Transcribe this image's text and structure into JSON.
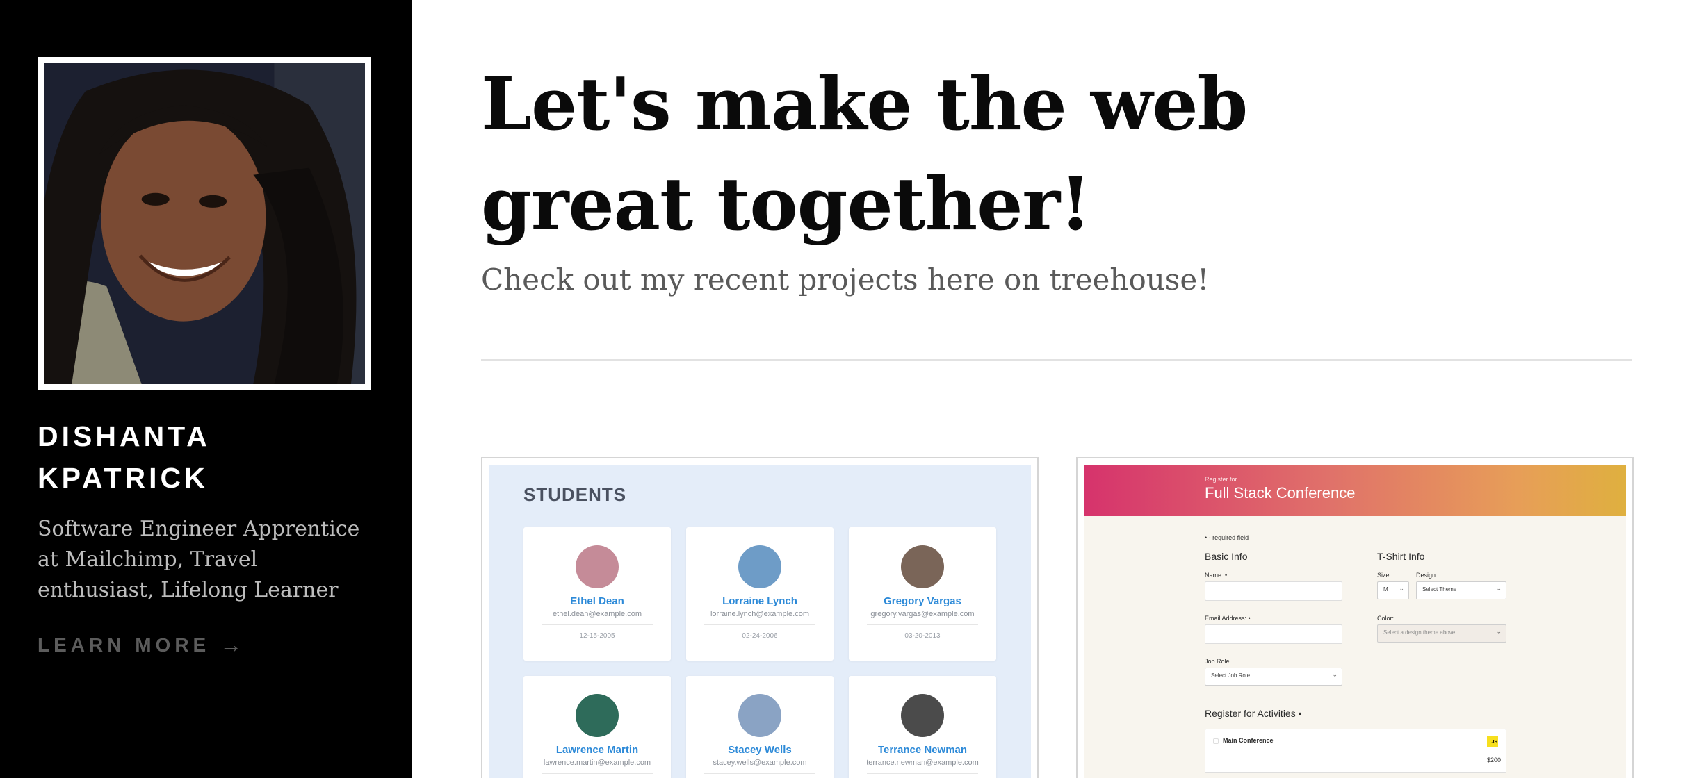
{
  "sidebar": {
    "avatar_alt": "Portrait of Dishanta Kpatrick",
    "name_line1": "DISHANTA",
    "name_line2": "KPATRICK",
    "bio": "Software Engineer Apprentice at Mailchimp, Travel enthusiast, Lifelong Learner",
    "learn_more": "LEARN MORE",
    "learn_more_arrow": "→",
    "background_color": "#000000"
  },
  "main": {
    "headline": "Let's make the web great together!",
    "subheadline": "Check out my recent projects here on treehouse!"
  },
  "projects": [
    {
      "title": "STUDENTS",
      "students": [
        {
          "name": "Ethel Dean",
          "email": "ethel.dean@example.com",
          "date": "12-15-2005",
          "color": "#c58b98"
        },
        {
          "name": "Lorraine Lynch",
          "email": "lorraine.lynch@example.com",
          "date": "02-24-2006",
          "color": "#6e9cc7"
        },
        {
          "name": "Gregory Vargas",
          "email": "gregory.vargas@example.com",
          "date": "03-20-2013",
          "color": "#7a6558"
        },
        {
          "name": "Lawrence Martin",
          "email": "lawrence.martin@example.com",
          "date": "",
          "color": "#2e6b5a"
        },
        {
          "name": "Stacey Wells",
          "email": "stacey.wells@example.com",
          "date": "",
          "color": "#8aa3c4"
        },
        {
          "name": "Terrance Newman",
          "email": "terrance.newman@example.com",
          "date": "",
          "color": "#4b4b4b"
        }
      ]
    },
    {
      "kicker": "Register for",
      "title": "Full Stack Conference",
      "required_note": "• - required field",
      "basic_info": "Basic Info",
      "name_label": "Name: •",
      "email_label": "Email Address: •",
      "job_role_label": "Job Role",
      "job_role_value": "Select Job Role",
      "tshirt_info": "T-Shirt Info",
      "size_label": "Size:",
      "size_value": "M",
      "design_label": "Design:",
      "design_value": "Select Theme",
      "color_label": "Color:",
      "color_value": "Select a design theme above",
      "activities_title": "Register for Activities •",
      "activity_main": "Main Conference",
      "activity_price": "$200",
      "js_badge": "JS"
    }
  ]
}
